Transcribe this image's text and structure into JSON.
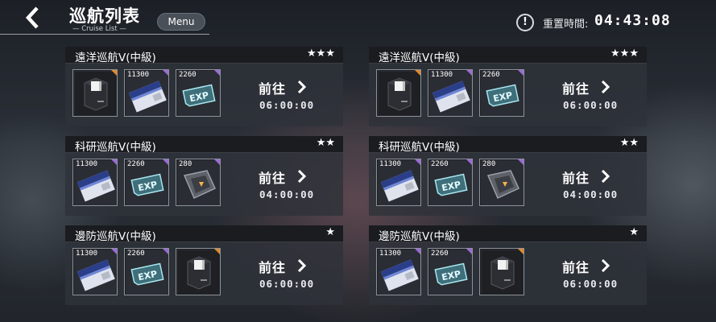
{
  "header": {
    "title": "巡航列表",
    "subtitle": "— Cruise List —",
    "menu_label": "Menu",
    "info_icon": "!",
    "reset_label": "重置時間:",
    "reset_time": "04:43:08"
  },
  "icons": {
    "back": "back-arrow-icon",
    "info": "info-icon",
    "go": "chevron-right-icon",
    "box": "supply-box-icon",
    "card": "data-card-icon",
    "exp": "exp-chip-icon",
    "module": "module-part-icon"
  },
  "colors": {
    "rarity_purple": "#9b6bd6",
    "rarity_orange": "#e08a2e"
  },
  "cruises": [
    {
      "name": "遠洋巡航Ⅴ(中級)",
      "stars": "★★★",
      "go_label": "前往",
      "duration": "06:00:00",
      "rewards": [
        {
          "type": "box",
          "qty": "",
          "rarity": "orange"
        },
        {
          "type": "card",
          "qty": "11300",
          "rarity": "purple"
        },
        {
          "type": "exp",
          "qty": "2260",
          "rarity": "purple"
        }
      ]
    },
    {
      "name": "遠洋巡航Ⅴ(中級)",
      "stars": "★★★",
      "go_label": "前往",
      "duration": "06:00:00",
      "rewards": [
        {
          "type": "box",
          "qty": "",
          "rarity": "orange"
        },
        {
          "type": "card",
          "qty": "11300",
          "rarity": "purple"
        },
        {
          "type": "exp",
          "qty": "2260",
          "rarity": "purple"
        }
      ]
    },
    {
      "name": "科研巡航Ⅴ(中級)",
      "stars": "★★",
      "go_label": "前往",
      "duration": "04:00:00",
      "rewards": [
        {
          "type": "card",
          "qty": "11300",
          "rarity": "purple"
        },
        {
          "type": "exp",
          "qty": "2260",
          "rarity": "purple"
        },
        {
          "type": "module",
          "qty": "280",
          "rarity": "purple"
        }
      ]
    },
    {
      "name": "科研巡航Ⅴ(中級)",
      "stars": "★★",
      "go_label": "前往",
      "duration": "04:00:00",
      "rewards": [
        {
          "type": "card",
          "qty": "11300",
          "rarity": "purple"
        },
        {
          "type": "exp",
          "qty": "2260",
          "rarity": "purple"
        },
        {
          "type": "module",
          "qty": "280",
          "rarity": "purple"
        }
      ]
    },
    {
      "name": "邊防巡航Ⅴ(中級)",
      "stars": "★",
      "go_label": "前往",
      "duration": "06:00:00",
      "rewards": [
        {
          "type": "card",
          "qty": "11300",
          "rarity": "purple"
        },
        {
          "type": "exp",
          "qty": "2260",
          "rarity": "purple"
        },
        {
          "type": "box",
          "qty": "",
          "rarity": "orange"
        }
      ]
    },
    {
      "name": "邊防巡航Ⅴ(中級)",
      "stars": "★",
      "go_label": "前往",
      "duration": "06:00:00",
      "rewards": [
        {
          "type": "card",
          "qty": "11300",
          "rarity": "purple"
        },
        {
          "type": "exp",
          "qty": "2260",
          "rarity": "purple"
        },
        {
          "type": "box",
          "qty": "",
          "rarity": "orange"
        }
      ]
    }
  ]
}
